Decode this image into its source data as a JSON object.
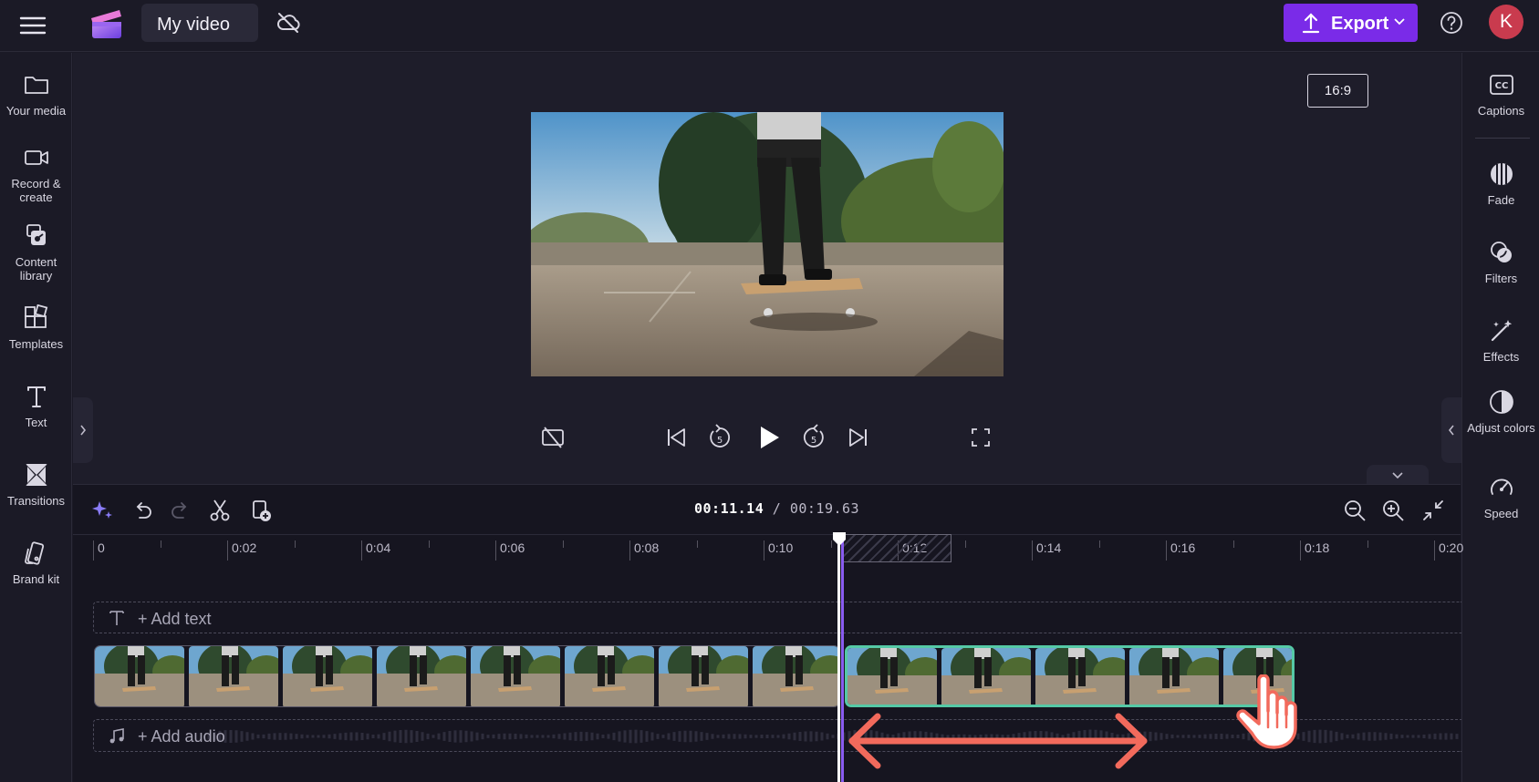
{
  "header": {
    "title": "My video",
    "export_label": "Export",
    "avatar_initial": "K"
  },
  "left_sidebar": {
    "items": [
      {
        "label": "Your media",
        "icon": "folder-icon"
      },
      {
        "label": "Record & create",
        "icon": "camera-icon"
      },
      {
        "label": "Content library",
        "icon": "content-library-icon"
      },
      {
        "label": "Templates",
        "icon": "templates-icon"
      },
      {
        "label": "Text",
        "icon": "text-icon"
      },
      {
        "label": "Transitions",
        "icon": "transitions-icon"
      },
      {
        "label": "Brand kit",
        "icon": "brand-kit-icon"
      }
    ]
  },
  "right_sidebar": {
    "items": [
      {
        "label": "Captions",
        "icon": "captions-icon"
      },
      {
        "label": "Fade",
        "icon": "fade-icon"
      },
      {
        "label": "Filters",
        "icon": "filters-icon"
      },
      {
        "label": "Effects",
        "icon": "effects-icon"
      },
      {
        "label": "Adjust colors",
        "icon": "adjust-colors-icon"
      },
      {
        "label": "Speed",
        "icon": "speed-icon"
      }
    ]
  },
  "preview": {
    "aspect_ratio": "16:9"
  },
  "timeline": {
    "current_time": "00:11.14",
    "separator": " / ",
    "total_time": "00:19.63",
    "ruler_labels": [
      "0",
      "0:02",
      "0:04",
      "0:06",
      "0:08",
      "0:10",
      "0:12",
      "0:14",
      "0:16",
      "0:18",
      "0:20"
    ],
    "add_text_label": "+ Add text",
    "add_audio_label": "+ Add audio"
  },
  "colors": {
    "accent": "#7a2be8",
    "selected_clip_border": "#55c9a6",
    "playhead": "#ffffff",
    "arrow": "#f26a5c",
    "avatar": "#c93b4e"
  }
}
